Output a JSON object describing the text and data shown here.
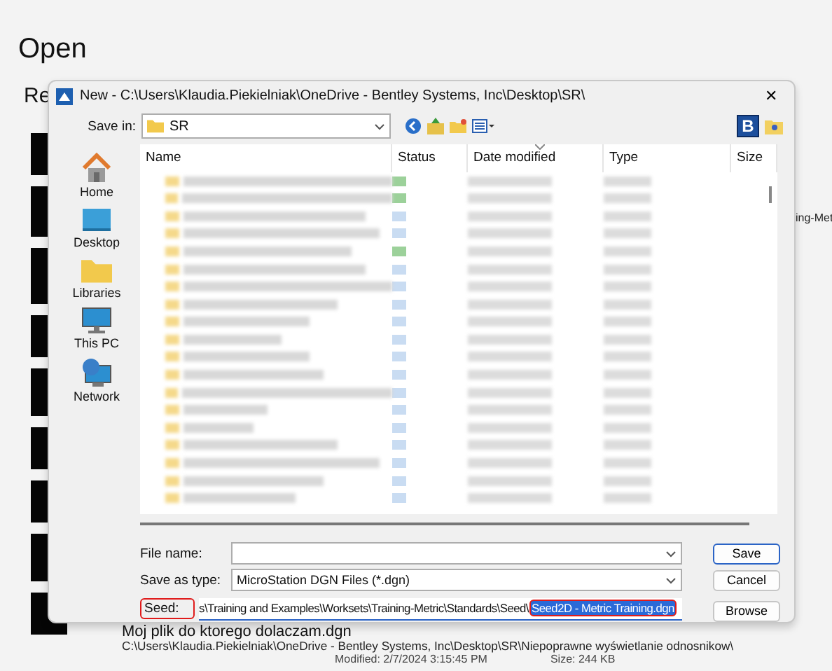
{
  "page": {
    "title": "Open",
    "section_heading": "Re",
    "side_text": "ing-Met",
    "recent_file": {
      "name": "Moj plik do ktorego dolaczam.dgn",
      "path": "C:\\Users\\Klaudia.Piekielniak\\OneDrive - Bentley Systems, Inc\\Desktop\\SR\\Niepoprawne wyświetlanie odnosnikow\\",
      "modified": "Modified: 2/7/2024 3:15:45 PM",
      "size": "Size: 244 KB"
    }
  },
  "dialog": {
    "title": "New - C:\\Users\\Klaudia.Piekielniak\\OneDrive - Bentley Systems, Inc\\Desktop\\SR\\",
    "close": "✕",
    "save_in": {
      "label": "Save in:",
      "value": "SR"
    },
    "logo_letter": "B",
    "places": [
      {
        "label": "Home",
        "kind": "home"
      },
      {
        "label": "Desktop",
        "kind": "desktop"
      },
      {
        "label": "Libraries",
        "kind": "libraries"
      },
      {
        "label": "This PC",
        "kind": "pc"
      },
      {
        "label": "Network",
        "kind": "network"
      }
    ],
    "columns": [
      {
        "label": "Name",
        "sorted": false
      },
      {
        "label": "Status",
        "sorted": false
      },
      {
        "label": "Date modified",
        "sorted": true
      },
      {
        "label": "Type",
        "sorted": false
      },
      {
        "label": "Size",
        "sorted": false
      }
    ],
    "rows": [
      {
        "color": "#9cd19a"
      },
      {
        "color": "#9cd19a"
      },
      {
        "color": "#c9dcf2"
      },
      {
        "color": "#c9dcf2"
      },
      {
        "color": "#9cd19a"
      },
      {
        "color": "#c9dcf2"
      },
      {
        "color": "#c9dcf2"
      },
      {
        "color": "#c9dcf2"
      },
      {
        "color": "#c9dcf2"
      },
      {
        "color": "#c9dcf2"
      },
      {
        "color": "#c9dcf2"
      },
      {
        "color": "#c9dcf2"
      },
      {
        "color": "#c9dcf2"
      },
      {
        "color": "#c9dcf2"
      },
      {
        "color": "#c9dcf2"
      },
      {
        "color": "#c9dcf2"
      },
      {
        "color": "#c9dcf2"
      },
      {
        "color": "#c9dcf2"
      },
      {
        "color": "#c9dcf2"
      }
    ],
    "file_name": {
      "label": "File name:"
    },
    "save_as_type": {
      "label": "Save as type:",
      "value": "MicroStation DGN Files (*.dgn)"
    },
    "seed": {
      "label": "Seed:",
      "value": "s\\Training and Examples\\Worksets\\Training-Metric\\Standards\\Seed\\",
      "selected_value": "Seed2D - Metric Training.dgn",
      "highlighted": true
    },
    "buttons": [
      {
        "label": "Save",
        "default": true
      },
      {
        "label": "Cancel",
        "default": false
      },
      {
        "label": "Browse",
        "default": false
      }
    ]
  }
}
